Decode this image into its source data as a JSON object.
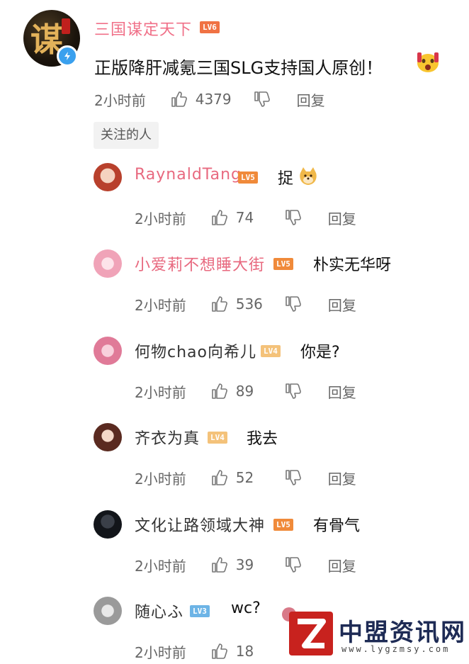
{
  "main_comment": {
    "username": "三国谋定天下",
    "level": "LV6",
    "text": "正版降肝减氪三国SLG支持国人原创！",
    "time": "2小时前",
    "likes": "4379",
    "reply_label": "回复",
    "avatar_glyph": "谋"
  },
  "follow_tag": "关注的人",
  "replies": [
    {
      "username": "RaynaldTang",
      "level": "LV5",
      "text": "捉",
      "time": "2小时前",
      "likes": "74",
      "reply_label": "回复",
      "name_color": "#e8697f"
    },
    {
      "username": "小爱莉不想睡大街",
      "level": "LV5",
      "text": "朴实无华呀",
      "time": "2小时前",
      "likes": "536",
      "reply_label": "回复",
      "name_color": "#e8697f"
    },
    {
      "username": "何物chao向希儿",
      "level": "LV4",
      "text": "你是?",
      "time": "2小时前",
      "likes": "89",
      "reply_label": "回复",
      "name_color": "#333333"
    },
    {
      "username": "齐衣为真",
      "level": "LV4",
      "text": "我去",
      "time": "2小时前",
      "likes": "52",
      "reply_label": "回复",
      "name_color": "#333333"
    },
    {
      "username": "文化让路领域大神",
      "level": "LV5",
      "text": "有骨气",
      "time": "2小时前",
      "likes": "39",
      "reply_label": "回复",
      "name_color": "#333333"
    },
    {
      "username": "随心ふ",
      "level": "LV3",
      "text": "wc?",
      "time": "2小时前",
      "likes": "18",
      "reply_label": "回复",
      "name_color": "#333333"
    }
  ],
  "watermark": {
    "title": "中盟资讯网",
    "url": "www.lygzmsy.com"
  }
}
